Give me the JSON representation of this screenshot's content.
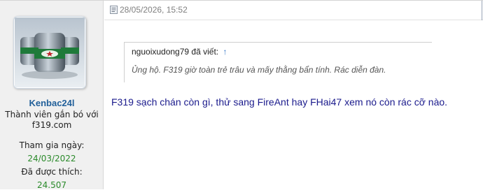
{
  "post": {
    "date": "28/05/2026, 15:52",
    "icon": "post-icon"
  },
  "user": {
    "username": "Kenbac24l",
    "title_line1": "Thành viên gắn bó với",
    "title_line2": "f319.com",
    "joined_label": "Tham gia ngày:",
    "joined_value": "24/03/2022",
    "likes_label": "Đã được thích:",
    "likes_value": "24.507",
    "avatar": "avatar-image"
  },
  "quote": {
    "author": "nguoixudong79",
    "said": "đã viết:",
    "arrow": "↑",
    "text": "Ủng hộ. F319 giờ toàn trẻ trâu và mấy thằng bẩn tính. Rác diễn đàn."
  },
  "message": {
    "text": "F319 sạch chán còn gì, thử sang FireAnt hay FHai47 xem nó còn rác cỡ nào."
  },
  "colors": {
    "username": "#22609a",
    "meta_value": "#2a8a2a",
    "message": "#1a1a8c",
    "sidebar_bg": "#f0f0f0"
  }
}
